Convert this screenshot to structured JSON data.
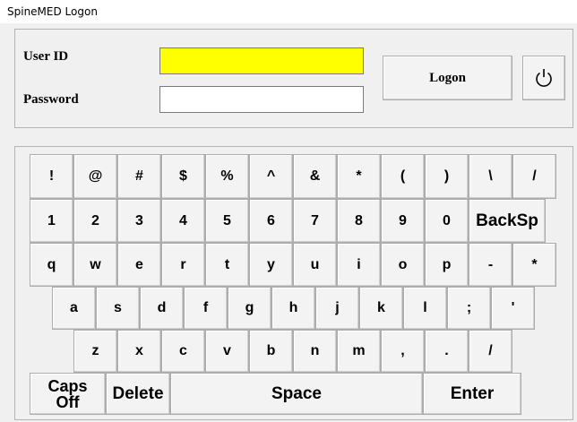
{
  "window": {
    "title": "SpineMED Logon"
  },
  "form": {
    "user_id_label": "User ID",
    "password_label": "Password",
    "user_id_value": "",
    "password_value": "",
    "logon_label": "Logon",
    "active_field_color": "#ffff00"
  },
  "power_button": {
    "icon": "power-icon"
  },
  "keyboard": {
    "rows": [
      [
        "!",
        "@",
        "#",
        "$",
        "%",
        "^",
        "&",
        "*",
        "(",
        ")",
        "\\",
        "/"
      ],
      [
        "1",
        "2",
        "3",
        "4",
        "5",
        "6",
        "7",
        "8",
        "9",
        "0",
        "BackSp"
      ],
      [
        "q",
        "w",
        "e",
        "r",
        "t",
        "y",
        "u",
        "i",
        "o",
        "p",
        "-",
        "*"
      ],
      [
        "a",
        "s",
        "d",
        "f",
        "g",
        "h",
        "j",
        "k",
        "l",
        ";",
        "'"
      ],
      [
        "z",
        "x",
        "c",
        "v",
        "b",
        "n",
        "m",
        ",",
        ".",
        "/"
      ],
      [
        "Caps Off",
        "Delete",
        "Space",
        "Enter"
      ]
    ]
  }
}
